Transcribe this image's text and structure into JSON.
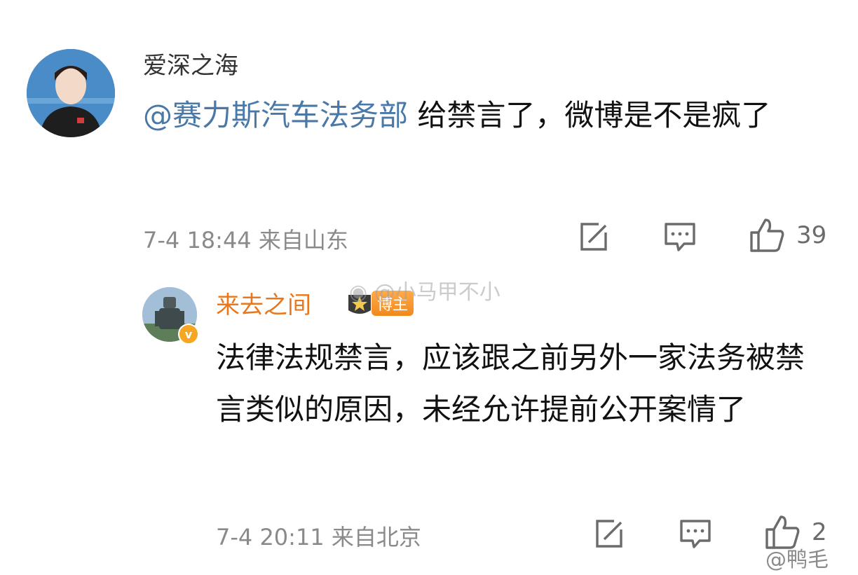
{
  "comments": [
    {
      "username": "爱深之海",
      "mention": "@赛力斯汽车法务部",
      "text": " 给禁言了，微博是不是疯了",
      "meta": "7-4 18:44 来自山东",
      "likes": "39"
    },
    {
      "username": "来去之间",
      "badge_label": "博主",
      "text": "法律法规禁言，应该跟之前另外一家法务被禁言类似的原因，未经允许提前公开案情了",
      "meta": "7-4 20:11 来自北京",
      "likes": "2"
    }
  ],
  "watermarks": {
    "top": "@小马甲不小",
    "bottom": "@鸭毛"
  },
  "colors": {
    "mention": "#4a79a8",
    "blogger_name": "#e8771e",
    "meta": "#8a8a8a",
    "icon": "#6b6b6b"
  },
  "icons": [
    "edit-icon",
    "comment-icon",
    "like-icon",
    "weibo-logo-icon",
    "verified-badge-icon"
  ]
}
